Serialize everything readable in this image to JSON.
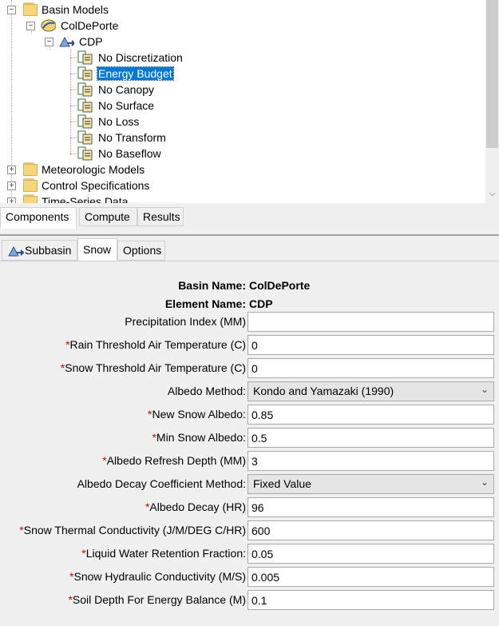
{
  "tree": {
    "items": [
      {
        "label": "Basin Models",
        "expander": "−"
      },
      {
        "label": "ColDePorte",
        "expander": "−"
      },
      {
        "label": "CDP",
        "expander": "−"
      },
      {
        "label": "No Discretization"
      },
      {
        "label": "Energy Budget",
        "selected": true
      },
      {
        "label": "No Canopy"
      },
      {
        "label": "No Surface"
      },
      {
        "label": "No Loss"
      },
      {
        "label": "No Transform"
      },
      {
        "label": "No Baseflow"
      },
      {
        "label": "Meteorologic Models",
        "expander": "+"
      },
      {
        "label": "Control Specifications",
        "expander": "+"
      },
      {
        "label": "Time-Series Data",
        "expander": "+"
      }
    ]
  },
  "bottom_tabs": [
    {
      "label": "Components",
      "active": true
    },
    {
      "label": "Compute"
    },
    {
      "label": "Results"
    }
  ],
  "editor_tabs": [
    {
      "label": "Subbasin",
      "icon": "subbasin-icon"
    },
    {
      "label": "Snow",
      "active": true
    },
    {
      "label": "Options"
    }
  ],
  "form": {
    "basin_name_label": "Basin Name:",
    "basin_name_value": "ColDePorte",
    "element_name_label": "Element Name:",
    "element_name_value": "CDP",
    "fields": [
      {
        "label": "Precipitation Index (MM)",
        "required": false,
        "value": ""
      },
      {
        "label": "Rain Threshold Air Temperature (C)",
        "required": true,
        "value": "0"
      },
      {
        "label": "Snow Threshold Air Temperature (C)",
        "required": true,
        "value": "0"
      },
      {
        "label": "Albedo Method:",
        "required": false,
        "value": "Kondo and Yamazaki (1990)",
        "type": "select"
      },
      {
        "label": "New Snow Albedo:",
        "required": true,
        "value": "0.85"
      },
      {
        "label": "Min Snow Albedo:",
        "required": true,
        "value": "0.5"
      },
      {
        "label": "Albedo Refresh Depth (MM)",
        "required": true,
        "value": "3"
      },
      {
        "label": "Albedo Decay Coefficient Method:",
        "required": false,
        "value": "Fixed Value",
        "type": "select"
      },
      {
        "label": "Albedo Decay (HR)",
        "required": true,
        "value": "96"
      },
      {
        "label": "Snow Thermal Conductivity (J/M/DEG C/HR)",
        "required": true,
        "value": "600"
      },
      {
        "label": "Liquid Water Retention Fraction:",
        "required": true,
        "value": "0.05"
      },
      {
        "label": "Snow Hydraulic Conductivity (M/S)",
        "required": true,
        "value": "0.005"
      },
      {
        "label": "Soil Depth For Energy Balance (M)",
        "required": true,
        "value": "0.1"
      }
    ]
  },
  "colors": {
    "selection": "#0078d7",
    "required_star": "#d40000"
  }
}
